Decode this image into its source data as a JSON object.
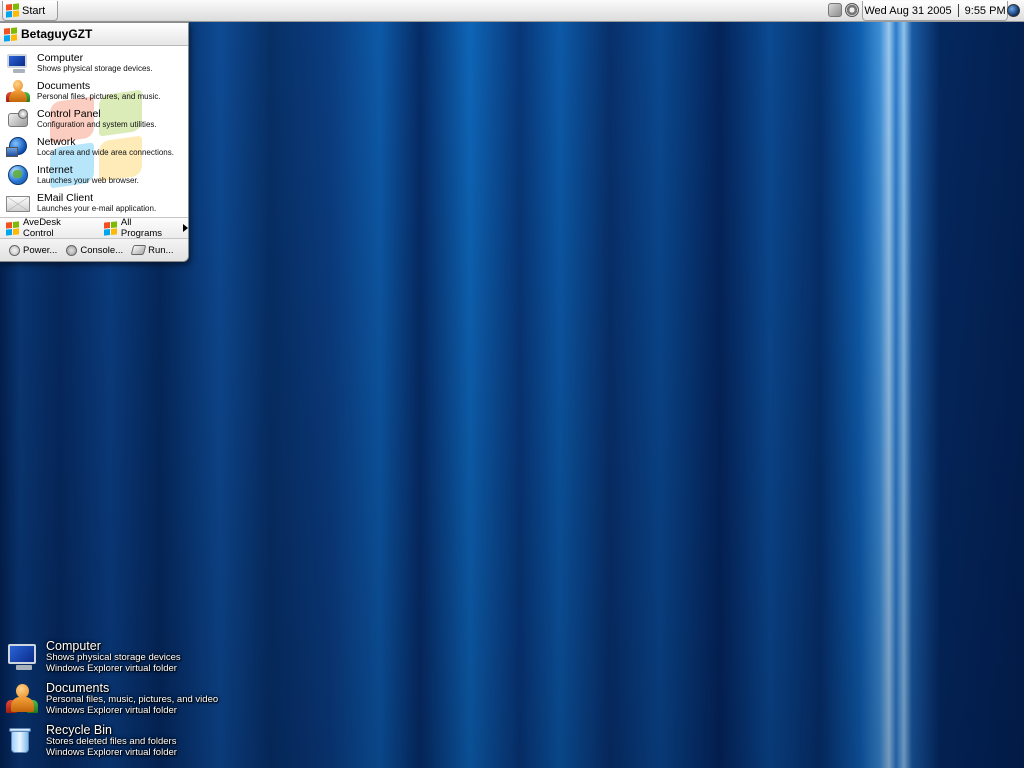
{
  "taskbar": {
    "start_label": "Start",
    "date": "Wed Aug 31 2005",
    "time": "9:55 PM",
    "tray_icons": [
      "network-icon",
      "volume-icon",
      "globe-icon"
    ]
  },
  "start_menu": {
    "user_name": "BetaguyGZT",
    "items": [
      {
        "title": "Computer",
        "desc": "Shows physical storage devices.",
        "icon": "computer-icon"
      },
      {
        "title": "Documents",
        "desc": "Personal files, pictures, and music.",
        "icon": "documents-icon"
      },
      {
        "title": "Control Panel",
        "desc": "Configuration and system utilities.",
        "icon": "control-panel-icon"
      },
      {
        "title": "Network",
        "desc": "Local area and wide area connections.",
        "icon": "network-icon"
      },
      {
        "title": "Internet",
        "desc": "Launches your web browser.",
        "icon": "internet-icon"
      },
      {
        "title": "EMail Client",
        "desc": "Launches your e-mail application.",
        "icon": "email-icon"
      }
    ],
    "avedesk_label": "AveDesk Control",
    "all_programs_label": "All Programs",
    "power_label": "Power...",
    "console_label": "Console...",
    "run_label": "Run..."
  },
  "desktop": {
    "items": [
      {
        "title": "Computer",
        "line1": "Shows physical storage devices",
        "line2": "Windows Explorer virtual folder",
        "icon": "computer-icon"
      },
      {
        "title": "Documents",
        "line1": "Personal files, music, pictures, and video",
        "line2": "Windows Explorer virtual folder",
        "icon": "documents-icon"
      },
      {
        "title": "Recycle Bin",
        "line1": "Stores deleted files and folders",
        "line2": "Windows Explorer virtual folder",
        "icon": "recycle-bin-icon"
      }
    ]
  },
  "colors": {
    "wallpaper_dark": "#03204f",
    "wallpaper_light": "#0e66b8",
    "highlight_streak": "#9cc9ef"
  }
}
